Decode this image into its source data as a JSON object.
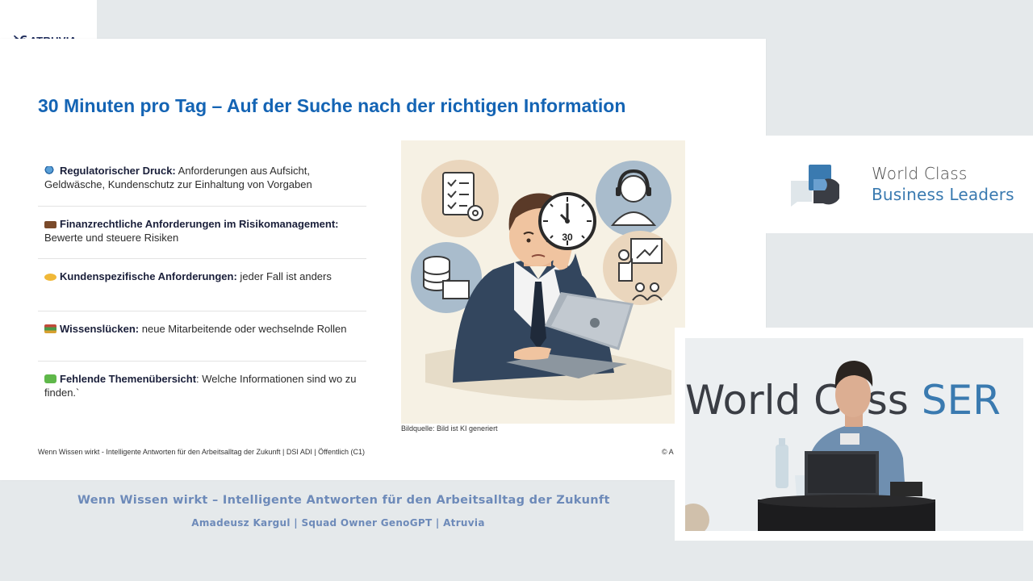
{
  "logo": {
    "mark": "ꝺ6",
    "text": "ATRUVIA"
  },
  "slide": {
    "title": "30 Minuten pro Tag – Auf der Suche nach der richtigen Information",
    "bullets": [
      {
        "icon": "magnifier-icon",
        "bold": "Regulatorischer Druck:",
        "text": " Anforderungen aus Aufsicht, Geldwäsche, Kundenschutz zur Einhaltung von Vorgaben"
      },
      {
        "icon": "briefcase-icon",
        "bold": "Finanzrechtliche Anforderungen im Risikomanagement:",
        "text": " Bewerte und steuere Risiken"
      },
      {
        "icon": "handshake-icon",
        "bold": "Kundenspezifische Anforderungen:",
        "text": " jeder Fall ist anders"
      },
      {
        "icon": "books-icon",
        "bold": "Wissenslücken:",
        "text": " neue Mitarbeitende oder wechselnde Rollen"
      },
      {
        "icon": "puzzle-icon",
        "bold": "Fehlende Themenübersicht",
        "text": ": Welche Informationen sind wo zu finden.`"
      }
    ],
    "clock_label": "30",
    "caption": "Bildquelle: Bild ist KI generiert",
    "footer": "Wenn Wissen wirkt - Intelligente Antworten für den Arbeitsalltag der Zukunft | DSI ADI | Öffentlich (C1)",
    "copyright": "© A"
  },
  "talk": {
    "title": "Wenn Wissen wirkt – Intelligente Antworten für den Arbeitsalltag der Zukunft",
    "speaker": "Amadeusz Kargul | Squad Owner GenoGPT | Atruvia"
  },
  "brand": {
    "line1": "World Class",
    "line2": "Business Leaders"
  },
  "video": {
    "bg_text_a": "World C",
    "bg_text_b": "ass ",
    "bg_text_c": "SER"
  },
  "colors": {
    "title_blue": "#1464b4",
    "caption_blue": "#6d8ab9",
    "brand_blue": "#3a7ab0",
    "background": "#e5e9eb"
  }
}
